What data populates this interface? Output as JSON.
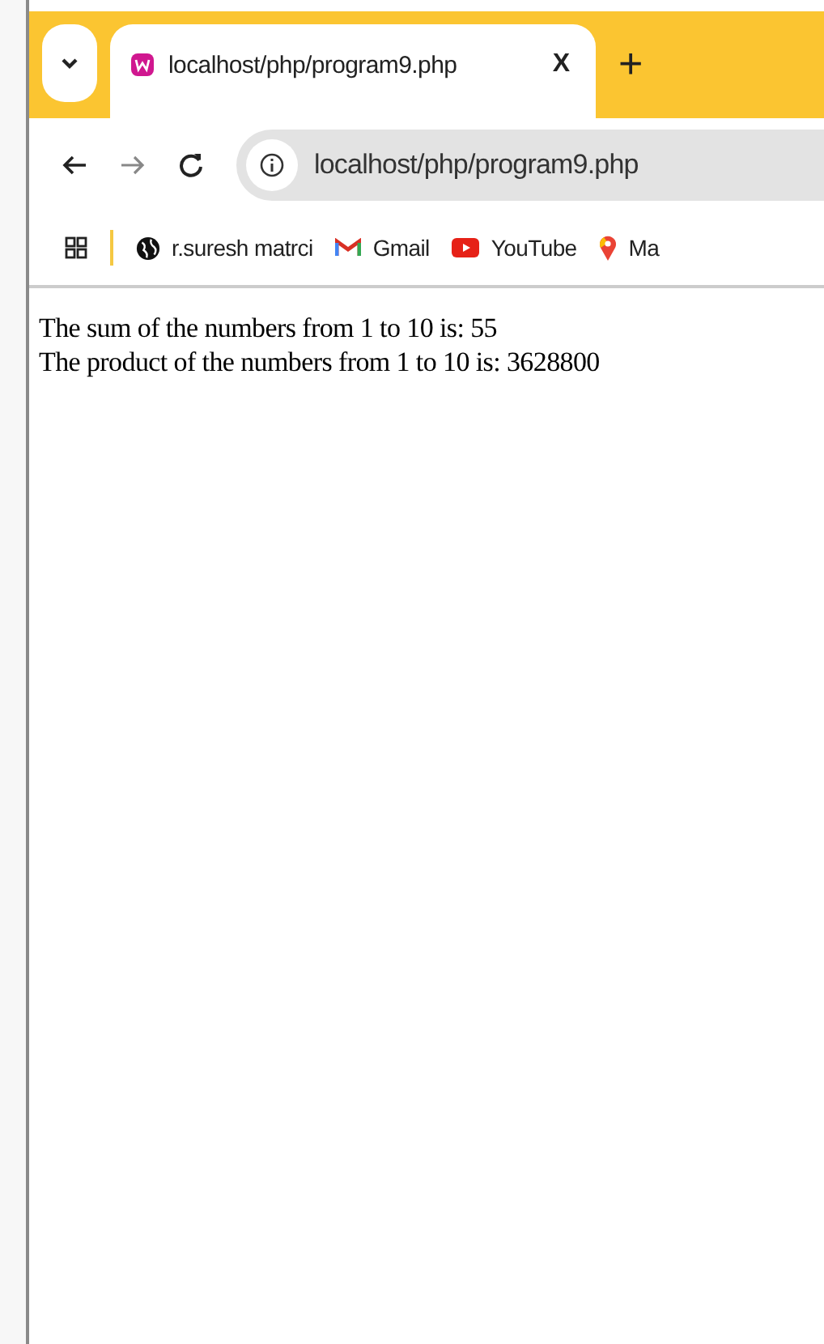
{
  "tabs": [
    {
      "title": "localhost/php/program9.php",
      "close": "X",
      "selected": true
    }
  ],
  "new_tab": "+",
  "address_bar": {
    "url": "localhost/php/program9.php"
  },
  "bookmarks": [
    {
      "kind": "globe",
      "label": "r.suresh matrci"
    },
    {
      "kind": "gmail",
      "label": "Gmail"
    },
    {
      "kind": "youtube",
      "label": "YouTube"
    },
    {
      "kind": "maps",
      "label": "Ma"
    }
  ],
  "page_lines": [
    "The sum of the numbers from 1 to 10 is: 55",
    "The product of the numbers from 1 to 10 is: 3628800"
  ]
}
